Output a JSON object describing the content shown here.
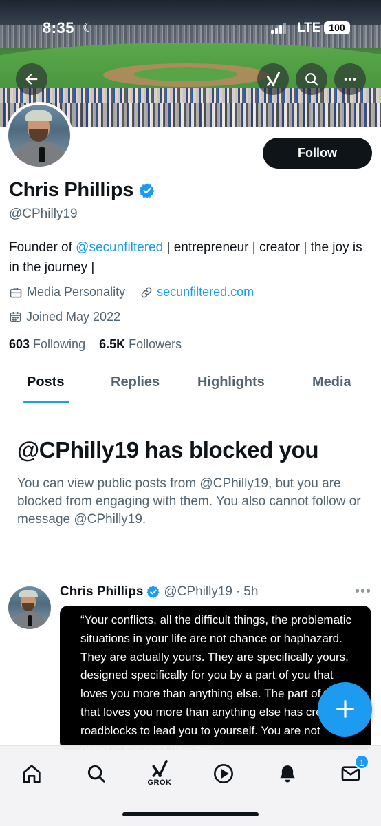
{
  "status_bar": {
    "time": "8:35",
    "network": "LTE",
    "battery": "100"
  },
  "profile": {
    "name": "Chris Phillips",
    "handle": "@CPhilly19",
    "follow_label": "Follow",
    "bio_prefix": "Founder of ",
    "bio_mention": "@secunfiltered",
    "bio_suffix": " | entrepreneur | creator | the joy is in the journey |",
    "category": "Media Personality",
    "website": "secunfiltered.com",
    "joined": "Joined May 2022",
    "following_count": "603",
    "following_label": "Following",
    "followers_count": "6.5K",
    "followers_label": "Followers"
  },
  "tabs": [
    {
      "label": "Posts",
      "active": true
    },
    {
      "label": "Replies"
    },
    {
      "label": "Highlights"
    },
    {
      "label": "Media"
    }
  ],
  "blocked": {
    "title": "@CPhilly19 has blocked you",
    "text": "You can view public posts from @CPhilly19, but you are blocked from engaging with them. You also cannot follow or message @CPhilly19."
  },
  "post": {
    "name": "Chris Phillips",
    "handle": "@CPhilly19",
    "separator": "·",
    "time": "5h",
    "quote": "“Your conflicts, all the difficult things, the problematic situations in your life are not chance or haphazard. They are actually yours. They are specifically yours, designed specifically for you by a part of you that loves you more than anything else. The part of you that loves you more than anything else has created roadblocks to lead you to yourself. You are not going in the right direction"
  },
  "bottom_nav": {
    "grok_label": "GROK",
    "messages_badge": "1"
  },
  "colors": {
    "accent": "#1d9bf0",
    "text": "#0f1419",
    "muted": "#536471"
  }
}
